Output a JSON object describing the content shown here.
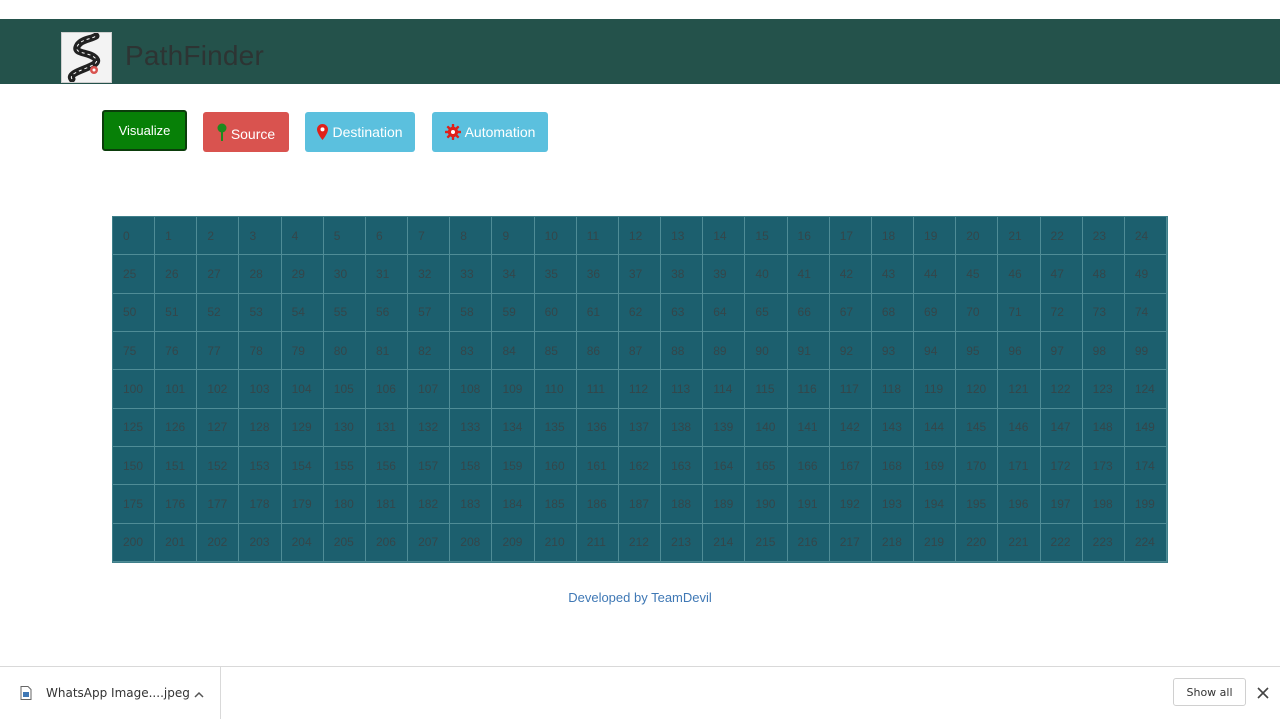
{
  "header": {
    "brand": "PathFinder",
    "logo_icon": "winding-road-pin-icon"
  },
  "toolbar": {
    "visualize_label": "Visualize",
    "source_label": "Source",
    "destination_label": "Destination",
    "automation_label": "Automation"
  },
  "grid": {
    "rows": 9,
    "cols": 25
  },
  "footer": {
    "credit": "Developed by TeamDevil"
  },
  "download_bar": {
    "file_name": "WhatsApp Image....jpeg",
    "show_all_label": "Show all"
  },
  "colors": {
    "header_bg": "#24524b",
    "grid_bg": "#1c5f6e",
    "visualize": "#078007",
    "source": "#d9534f",
    "destination": "#5bc0de",
    "automation": "#5bc0de"
  }
}
